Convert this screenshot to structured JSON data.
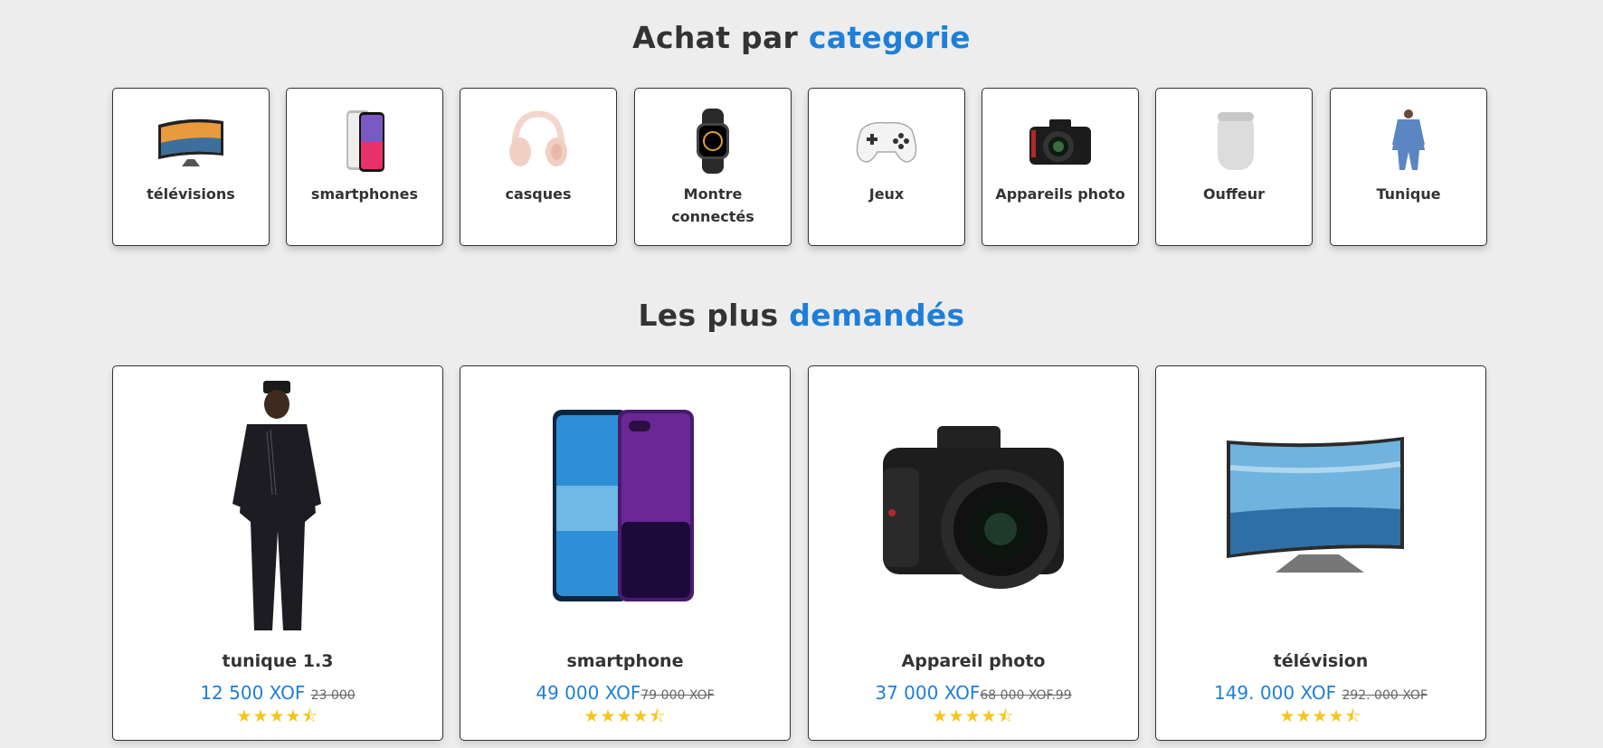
{
  "categories_section": {
    "title_main": "Achat par ",
    "title_accent": "categorie",
    "items": [
      {
        "label": "télévisions",
        "icon": "tv-icon"
      },
      {
        "label": "smartphones",
        "icon": "smartphone-icon"
      },
      {
        "label": "casques",
        "icon": "headphones-icon"
      },
      {
        "label": "Montre connectés",
        "icon": "smartwatch-icon"
      },
      {
        "label": "Jeux",
        "icon": "gamepad-icon"
      },
      {
        "label": "Appareils photo",
        "icon": "camera-icon"
      },
      {
        "label": "Ouffeur",
        "icon": "speaker-icon"
      },
      {
        "label": "Tunique",
        "icon": "tunic-icon"
      }
    ]
  },
  "popular_section": {
    "title_main": "Les plus ",
    "title_accent": "demandés",
    "products": [
      {
        "name": "tunique 1.3",
        "price": "12 500 XOF",
        "old_price": "23 000",
        "rating": 4.5,
        "stars": "★★★★⯪"
      },
      {
        "name": "smartphone",
        "price": "49 000 XOF",
        "old_price": "79 000 XOF",
        "rating": 4.5,
        "stars": "★★★★⯪"
      },
      {
        "name": "Appareil photo",
        "price": "37 000 XOF",
        "old_price": "68 000 XOF.99",
        "rating": 4.5,
        "stars": "★★★★⯪"
      },
      {
        "name": "télévision",
        "price": "149. 000 XOF",
        "old_price": "292. 000 XOF",
        "rating": 4.5,
        "stars": "★★★★⯪"
      }
    ]
  },
  "colors": {
    "accent": "#1e7fd9",
    "star": "#f5c518",
    "background": "#ededed"
  }
}
